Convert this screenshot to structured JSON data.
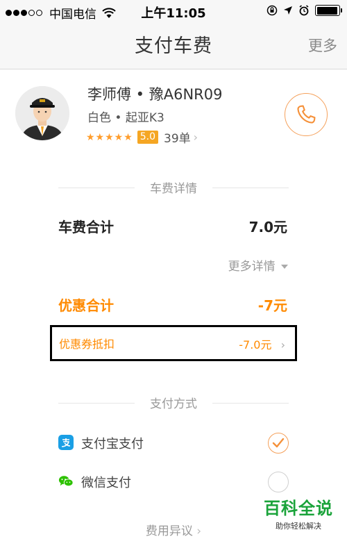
{
  "status_bar": {
    "carrier": "中国电信",
    "time": "上午11:05",
    "signal_dots": {
      "filled": 3,
      "total": 5
    },
    "battery_level": 0.95
  },
  "nav": {
    "title": "支付车费",
    "more": "更多"
  },
  "driver": {
    "name": "李师傅 • 豫A6NR09",
    "car": "白色 • 起亚K3",
    "stars": "★★★★★",
    "score": "5.0",
    "orders": "39单"
  },
  "fee_section": {
    "heading": "车费详情",
    "total_label": "车费合计",
    "total_value": "7.0元",
    "more_details": "更多详情",
    "discount_label": "优惠合计",
    "discount_value": "-7元",
    "coupon_label": "优惠券抵扣",
    "coupon_value": "-7.0元"
  },
  "payment_section": {
    "heading": "支付方式",
    "methods": [
      {
        "label": "支付宝支付",
        "icon": "alipay-icon",
        "selected": true,
        "color": "#1a9fe5"
      },
      {
        "label": "微信支付",
        "icon": "wechat-icon",
        "selected": false,
        "color": "#2dc100"
      }
    ]
  },
  "dispute_link": "费用异议",
  "watermark": {
    "title": "百科全说",
    "subtitle": "助你轻松解决"
  },
  "colors": {
    "accent": "#ff8a00",
    "star": "#ff9d2c",
    "alipay": "#1a9fe5",
    "wechat": "#2dc100",
    "watermark": "#1aa33a"
  }
}
